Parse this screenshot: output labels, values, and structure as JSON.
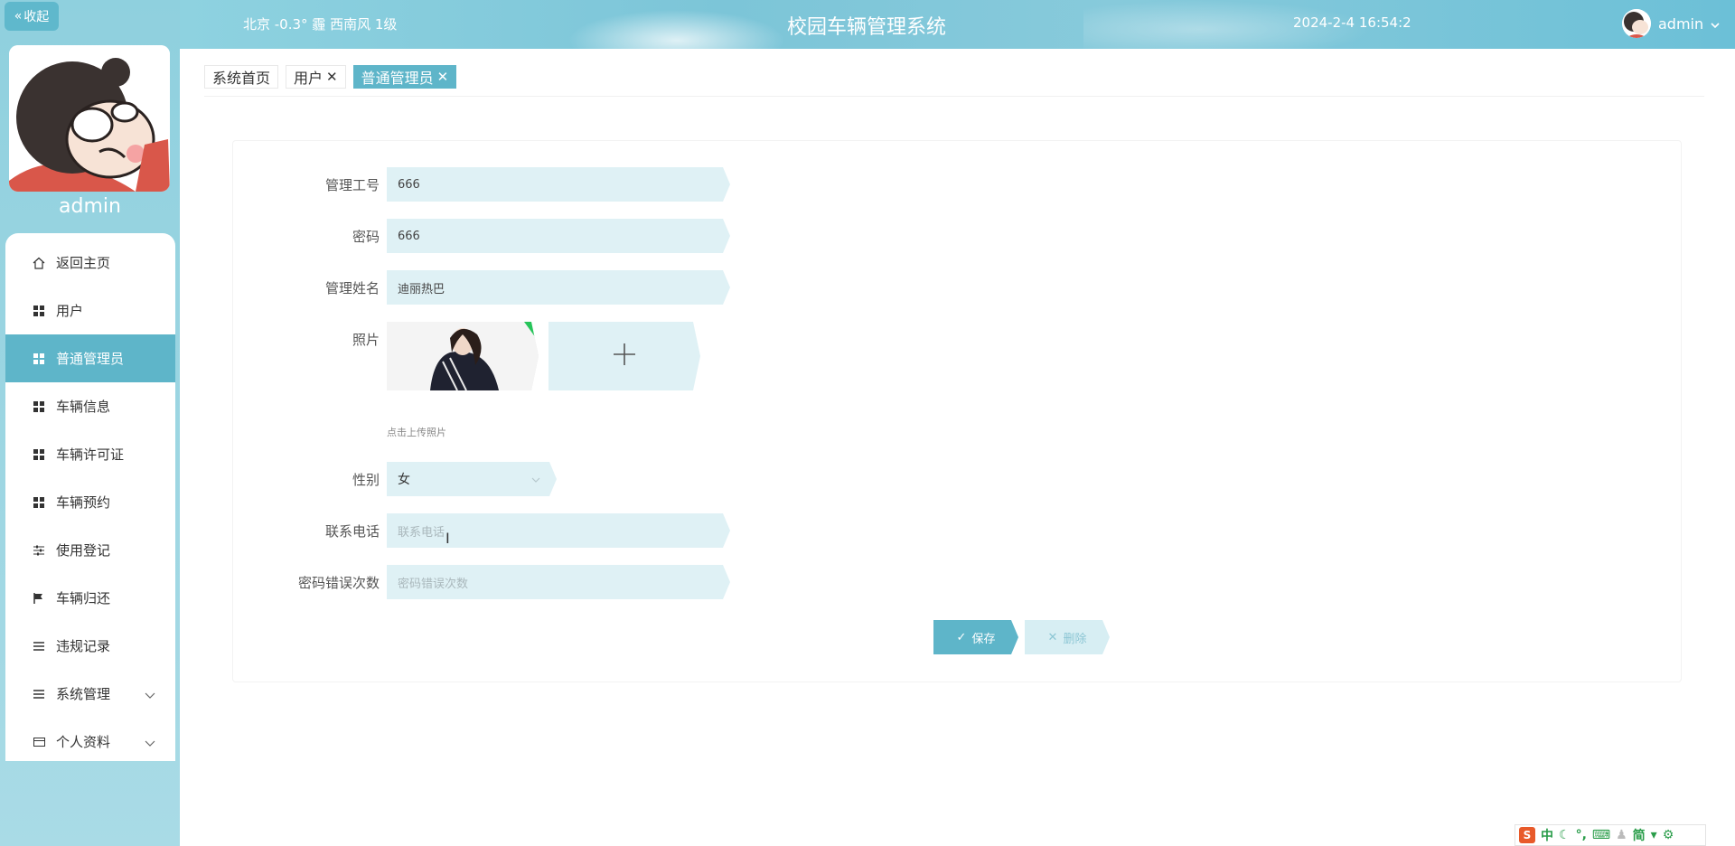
{
  "sidebar": {
    "collapse_label": "收起",
    "username": "admin",
    "items": [
      {
        "label": "返回主页",
        "icon": "home-icon"
      },
      {
        "label": "用户",
        "icon": "grid-icon"
      },
      {
        "label": "普通管理员",
        "icon": "grid-icon",
        "active": true
      },
      {
        "label": "车辆信息",
        "icon": "grid-icon"
      },
      {
        "label": "车辆许可证",
        "icon": "grid-icon"
      },
      {
        "label": "车辆预约",
        "icon": "grid-icon"
      },
      {
        "label": "使用登记",
        "icon": "sliders-icon"
      },
      {
        "label": "车辆归还",
        "icon": "flag-icon"
      },
      {
        "label": "违规记录",
        "icon": "list-icon"
      },
      {
        "label": "系统管理",
        "icon": "list-icon",
        "expandable": true
      },
      {
        "label": "个人资料",
        "icon": "card-icon",
        "expandable": true
      }
    ]
  },
  "header": {
    "weather": "北京  -0.3°  霾  西南风  1级",
    "title": "校园车辆管理系统",
    "datetime": "2024-2-4 16:54:2",
    "user": "admin"
  },
  "tabs": [
    {
      "label": "系统首页",
      "closable": false
    },
    {
      "label": "用户",
      "closable": true
    },
    {
      "label": "普通管理员",
      "closable": true,
      "active": true
    }
  ],
  "form": {
    "admin_id": {
      "label": "管理工号",
      "value": "666"
    },
    "password": {
      "label": "密码",
      "value": "666"
    },
    "admin_name": {
      "label": "管理姓名",
      "value": "迪丽热巴"
    },
    "photo": {
      "label": "照片",
      "hint": "点击上传照片"
    },
    "gender": {
      "label": "性别",
      "value": "女"
    },
    "phone": {
      "label": "联系电话",
      "placeholder": "联系电话"
    },
    "pwd_errors": {
      "label": "密码错误次数",
      "placeholder": "密码错误次数"
    },
    "save_label": "保存",
    "delete_label": "删除"
  },
  "ime": {
    "items": [
      "中",
      "简"
    ]
  },
  "colors": {
    "accent": "#5eb5c9",
    "field_bg": "#dff1f5",
    "sidebar_bg": "#8fd0de"
  }
}
